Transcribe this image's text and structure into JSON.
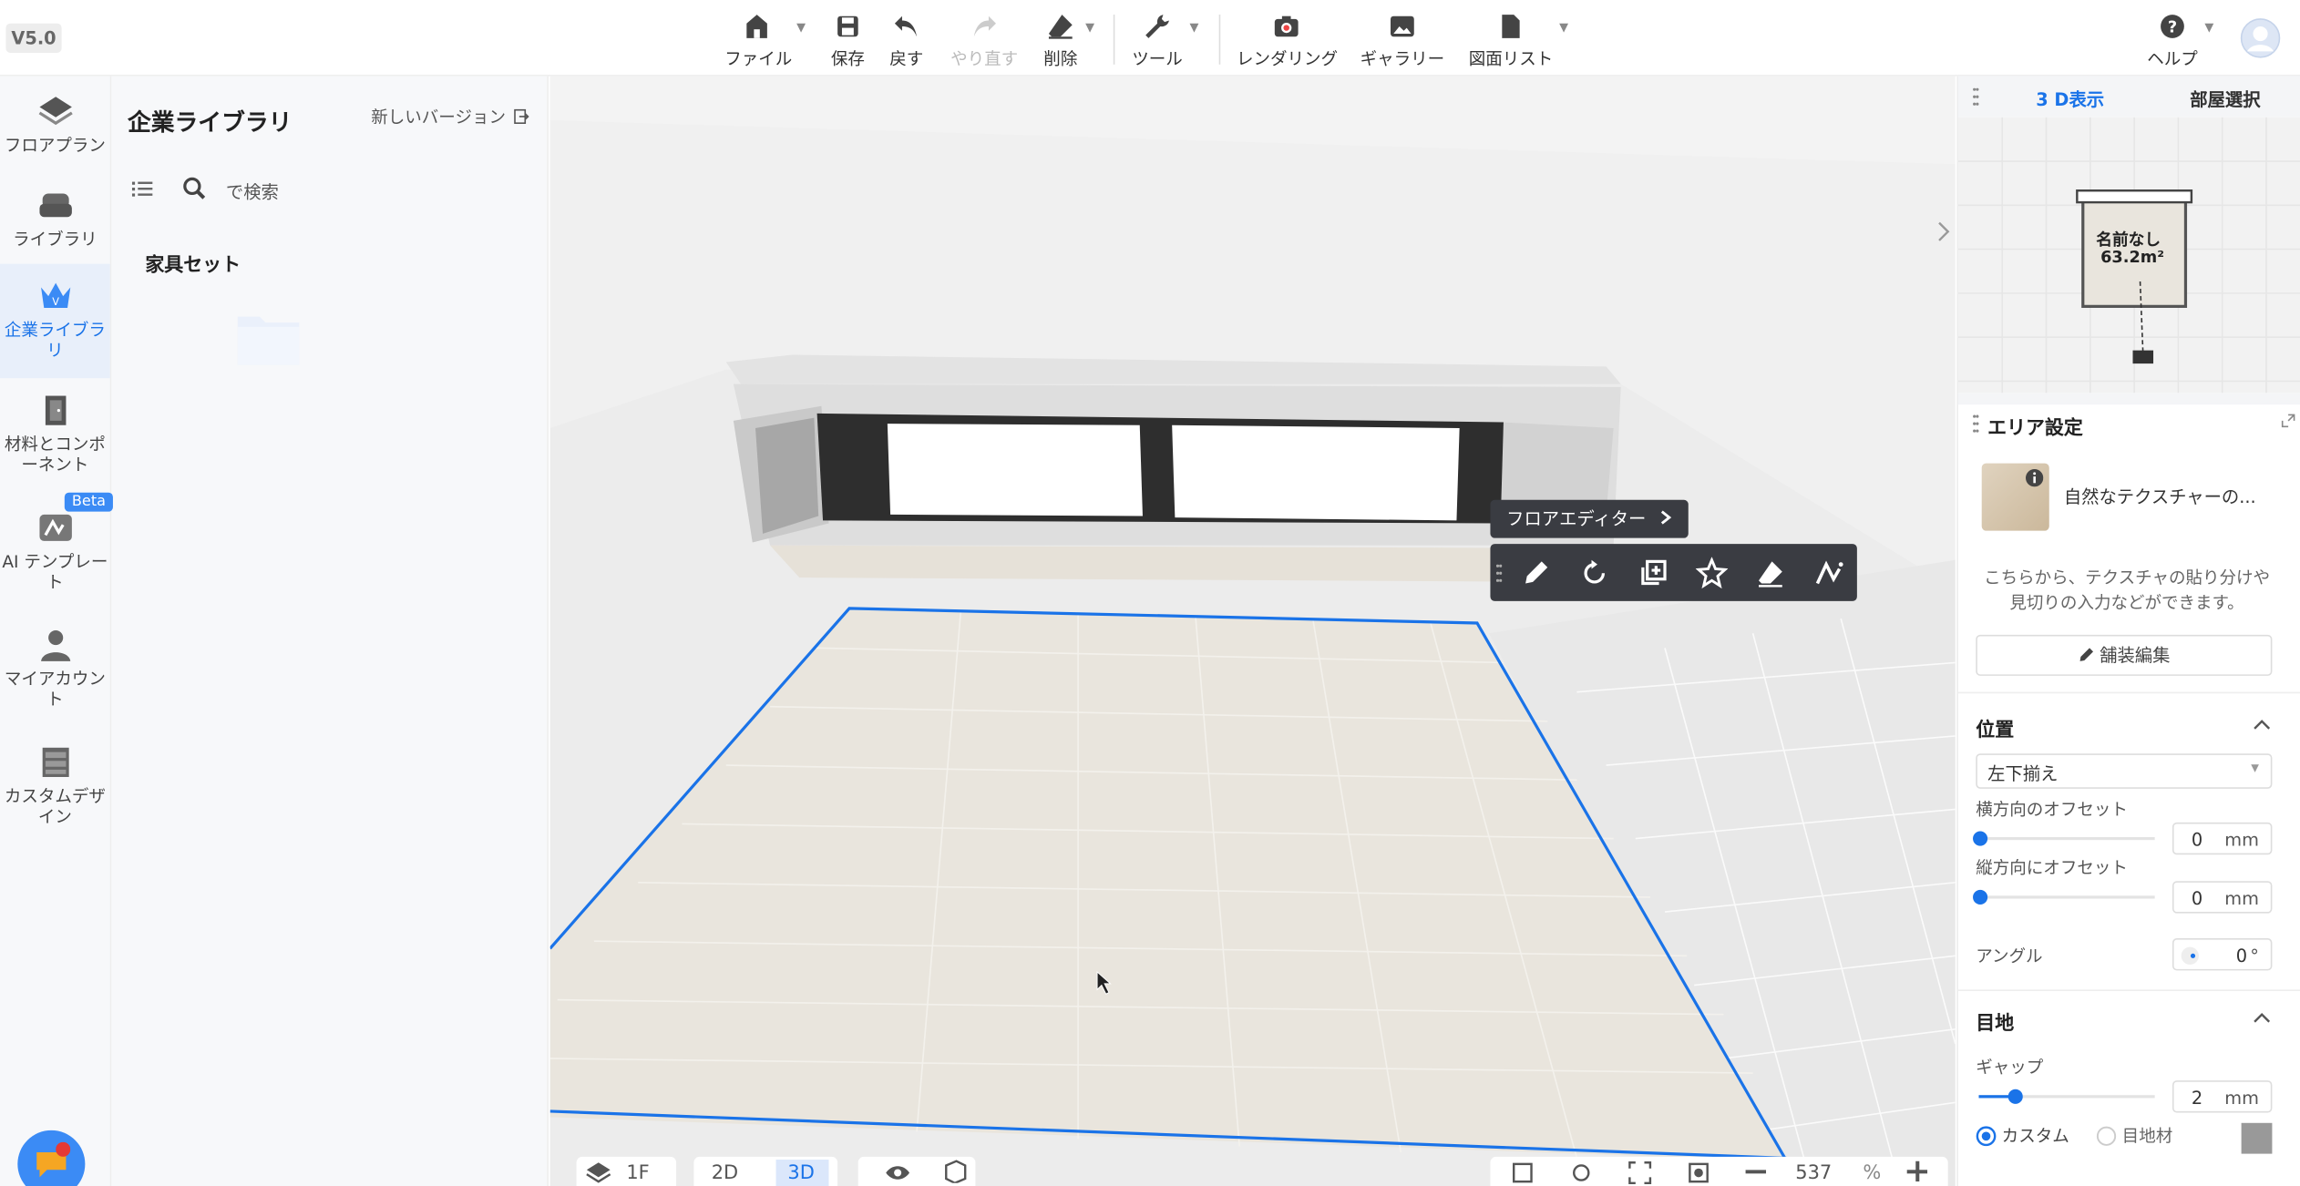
{
  "version": "V5.0",
  "toolbar": {
    "file": "ファイル",
    "save": "保存",
    "undo": "戻す",
    "redo": "やり直す",
    "delete": "削除",
    "tools": "ツール",
    "rendering": "レンダリング",
    "gallery": "ギャラリー",
    "drawing_list": "図面リスト",
    "help": "ヘルプ"
  },
  "leftnav": {
    "floorplan": "フロアプラン",
    "library": "ライブラリ",
    "enterprise_library": "企業ライブラリ",
    "materials": "材料とコンポーネント",
    "ai_template": "AI テンプレート",
    "beta": "Beta",
    "my_account": "マイアカウント",
    "custom_design": "カスタムデザイン"
  },
  "library": {
    "title": "企業ライブラリ",
    "new_version": "新しいバージョン",
    "search_placeholder": "で検索",
    "section": "家具セット"
  },
  "viewport": {
    "floor_editor": "フロアエディター",
    "floor": "1F",
    "mode_2d": "2D",
    "mode_3d": "3D",
    "zoom": "537",
    "zoom_unit": "%"
  },
  "rightpanel": {
    "tab_3d": "3 D表示",
    "tab_room": "部屋選択",
    "room_name": "名前なし",
    "room_area": "63.2m²",
    "area_settings": "エリア設定",
    "texture_name": "自然なテクスチャーの...",
    "description": "こちらから、テクスチャの貼り分けや見切りの入力などができます。",
    "paving_edit": "舗装編集",
    "position": "位置",
    "alignment": "左下揃え",
    "h_offset_label": "横方向のオフセット",
    "h_offset": "0",
    "v_offset_label": "縦方向にオフセット",
    "v_offset": "0",
    "unit_mm": "mm",
    "angle_label": "アングル",
    "angle": "0",
    "angle_unit": "°",
    "joint": "目地",
    "gap_label": "ギャップ",
    "gap": "2",
    "custom": "カスタム",
    "joint_material": "目地材"
  },
  "colors": {
    "accent": "#1a73e8",
    "dark_toolbar": "#3a3c42",
    "panel_bg": "#f7f8fa"
  }
}
